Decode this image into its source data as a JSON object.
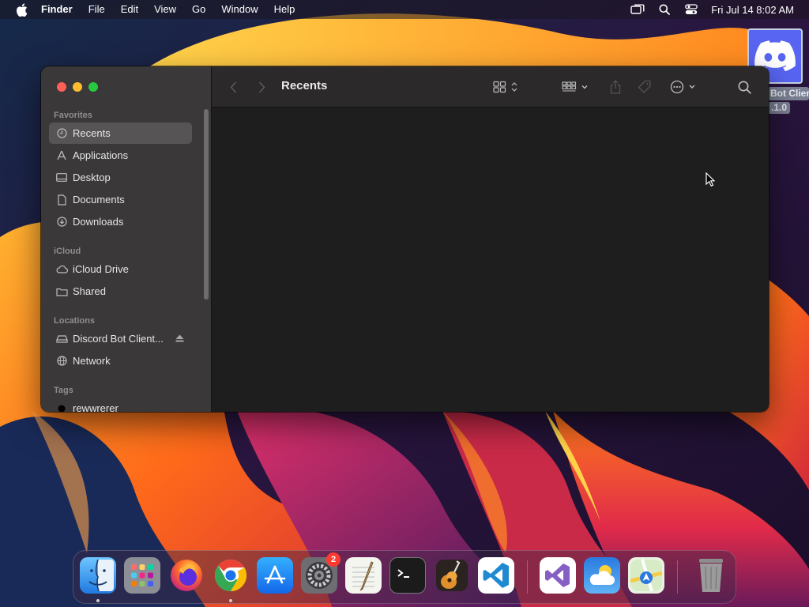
{
  "menubar": {
    "app_name": "Finder",
    "menus": [
      "File",
      "Edit",
      "View",
      "Go",
      "Window",
      "Help"
    ],
    "clock": "Fri Jul 14  8:02 AM",
    "status_icons": [
      "screen-mirroring-icon",
      "spotlight-search-icon",
      "control-center-icon"
    ]
  },
  "desktop_icon": {
    "label_line1": "Bot Clien",
    "label_line2": ".1.0",
    "icon": "discord-icon"
  },
  "finder": {
    "title": "Recents",
    "sidebar": {
      "favorites_header": "Favorites",
      "favorites": [
        {
          "label": "Recents",
          "icon": "clock-icon",
          "selected": true
        },
        {
          "label": "Applications",
          "icon": "applications-icon"
        },
        {
          "label": "Desktop",
          "icon": "desktop-icon"
        },
        {
          "label": "Documents",
          "icon": "document-icon"
        },
        {
          "label": "Downloads",
          "icon": "download-icon"
        }
      ],
      "icloud_header": "iCloud",
      "icloud": [
        {
          "label": "iCloud Drive",
          "icon": "cloud-icon"
        },
        {
          "label": "Shared",
          "icon": "shared-folder-icon"
        }
      ],
      "locations_header": "Locations",
      "locations": [
        {
          "label": "Discord Bot Client...",
          "icon": "drive-icon",
          "eject": true
        },
        {
          "label": "Network",
          "icon": "globe-icon"
        }
      ],
      "tags_header": "Tags",
      "tags": [
        {
          "label": "rewwrerer",
          "color": "#000000"
        }
      ]
    }
  },
  "dock": {
    "apps": [
      {
        "name": "Finder",
        "running": true
      },
      {
        "name": "Launchpad"
      },
      {
        "name": "Firefox"
      },
      {
        "name": "Google Chrome",
        "running": true
      },
      {
        "name": "App Store"
      },
      {
        "name": "System Settings",
        "badge": "2"
      },
      {
        "name": "TextEdit"
      },
      {
        "name": "Terminal"
      },
      {
        "name": "GarageBand"
      },
      {
        "name": "Visual Studio Code"
      },
      {
        "name": "Visual Studio"
      },
      {
        "name": "Weather"
      },
      {
        "name": "Maps"
      },
      {
        "name": "Trash"
      }
    ]
  },
  "colors": {
    "selected_sidebar": "#565454",
    "close": "#ff5f57",
    "minimize": "#febc2e",
    "maximize": "#28c840"
  }
}
